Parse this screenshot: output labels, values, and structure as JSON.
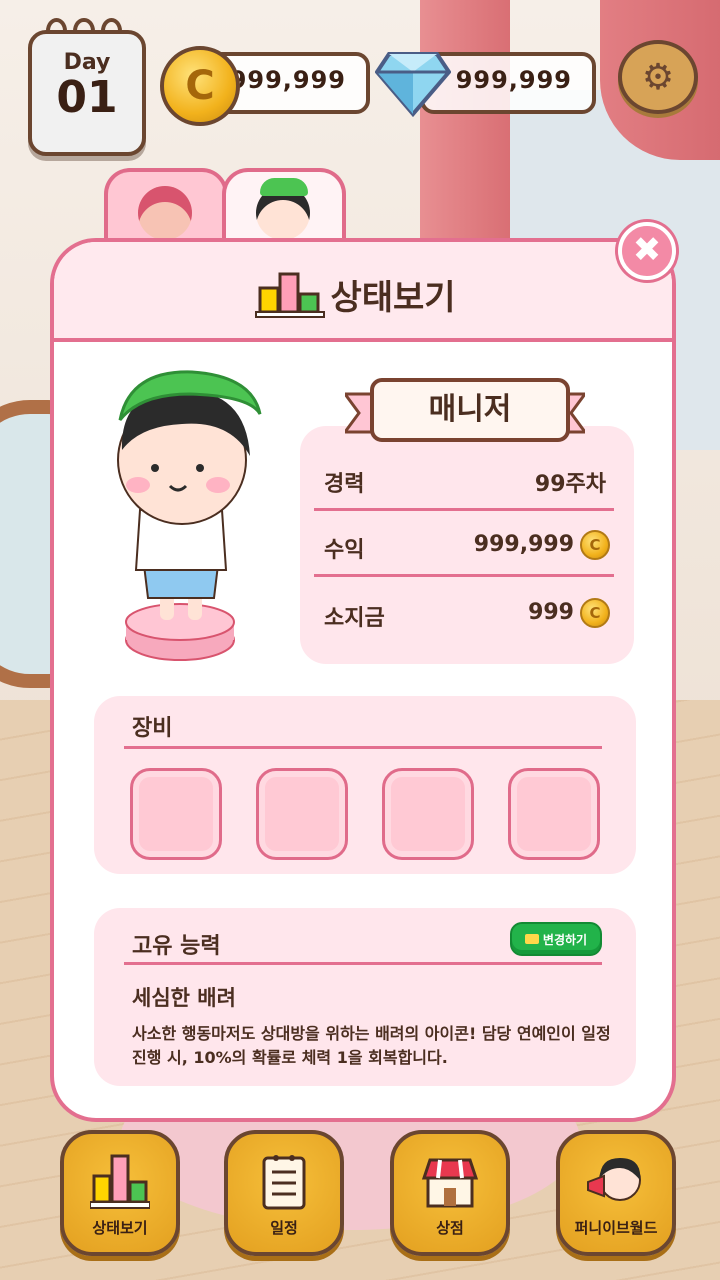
{
  "hud": {
    "day_label": "Day",
    "day_number": "01",
    "coins": "999,999",
    "coin_symbol": "C",
    "gems": "999,999",
    "settings_icon": "gear-icon"
  },
  "tabs": [
    {
      "name": "tab-character-girl",
      "selected": false
    },
    {
      "name": "tab-character-manager",
      "selected": true
    }
  ],
  "panel": {
    "title": "상태보기",
    "title_icon": "bar-chart-icon",
    "close_label": "✖"
  },
  "character": {
    "role": "매니저"
  },
  "stats": [
    {
      "key": "경력",
      "value": "99주차",
      "coin": false
    },
    {
      "key": "수익",
      "value": "999,999",
      "coin": true
    },
    {
      "key": "소지금",
      "value": "999",
      "coin": true
    }
  ],
  "coin_symbol": "C",
  "equipment": {
    "title": "장비",
    "slots": 4
  },
  "ability": {
    "title": "고유 능력",
    "change_label": "변경하기",
    "name": "세심한 배려",
    "description": "사소한 행동마저도 상대방을 위하는 배려의 아이콘! 담당 연예인이 일정 진행 시, 10%의 확률로 체력 1을 회복합니다."
  },
  "nav": [
    {
      "label": "상태보기",
      "icon": "bar-chart-icon"
    },
    {
      "label": "일정",
      "icon": "schedule-icon"
    },
    {
      "label": "상점",
      "icon": "shop-icon"
    },
    {
      "label": "퍼니이브월드",
      "icon": "megaphone-girl-icon"
    }
  ],
  "colors": {
    "accent_pink": "#e36f8f",
    "panel_pink": "#ffe6ec",
    "brown": "#4b2e20",
    "gold": "#e3a020",
    "green": "#22b34a"
  }
}
